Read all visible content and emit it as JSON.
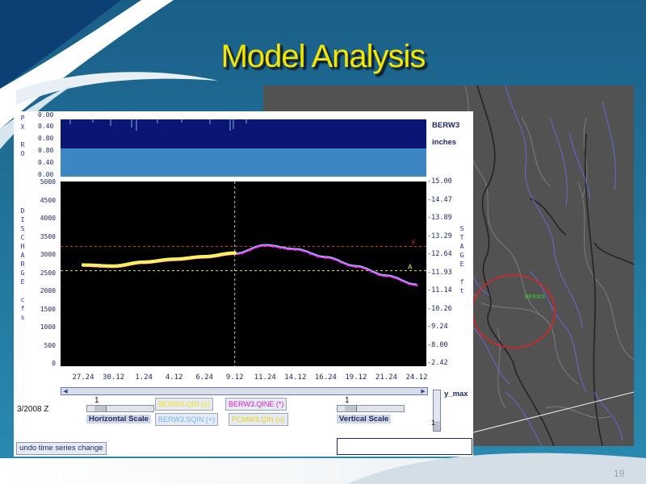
{
  "slide": {
    "title": "Model Analysis",
    "page_number": "19"
  },
  "top_strip": {
    "labels_left": [
      "P",
      "X",
      "",
      "R",
      "O"
    ],
    "ticks": [
      "0.00",
      "0.40",
      "0.80",
      "0.80",
      "0.40",
      "0.00"
    ],
    "station": "BERW3",
    "units": "inches"
  },
  "discharge_plot": {
    "left_axis_label": "DISCHARGE  cfs",
    "left_ticks": [
      "5000",
      "4500",
      "4000",
      "3500",
      "3000",
      "2500",
      "2000",
      "1500",
      "1000",
      "500",
      "0"
    ],
    "right_axis_label": "STAGE ft",
    "right_ticks": [
      "15.00",
      "14.47",
      "13.89",
      "13.29",
      "12.64",
      "11.93",
      "11.14",
      "10.26",
      "9.24",
      "8.00",
      "2.42"
    ],
    "x_ticks": [
      "27.24",
      "30.12",
      "1.24",
      "4.12",
      "6.24",
      "9.12",
      "11.24",
      "14.12",
      "16.24",
      "19.12",
      "21.24",
      "24.12"
    ],
    "flood_marker": "F",
    "action_marker": "A",
    "colors": {
      "background": "#000000",
      "observed": "#f5f25a",
      "simulated": "#ff33ff",
      "sqin": "#7fd8ff",
      "flood_line": "#d23a1a",
      "action_line": "#e8e84a",
      "cursor_line": "#c8c8c8"
    }
  },
  "chart_data": {
    "type": "line",
    "x": [
      "27.24",
      "30.12",
      "1.24",
      "4.12",
      "6.24",
      "9.12",
      "11.24",
      "14.12",
      "16.24",
      "19.12",
      "21.24",
      "24.12"
    ],
    "series": [
      {
        "name": "BERW3.QINE (*)",
        "values": [
          2750,
          2720,
          2830,
          2910,
          2980,
          3080,
          3320,
          3210,
          2990,
          2740,
          2480,
          2230
        ]
      },
      {
        "name": "BERW3.SQIN (+)",
        "values": [
          2770,
          2740,
          2850,
          2950,
          3010,
          3110,
          3350,
          3240,
          3020,
          2770,
          2510,
          2260
        ]
      }
    ],
    "ylim": [
      0,
      5000
    ],
    "flood_level": 3300,
    "action_level": 2630
  },
  "controls": {
    "date_text": "3/2008 Z",
    "horizontal_value": "1",
    "horizontal_label": "Horizontal Scale",
    "vertical_value": "1",
    "vertical_label": "Vertical Scale",
    "y_max_label": "y_max",
    "legend": [
      {
        "label": "BERW3.QIN (o)",
        "color": "#f5e21c"
      },
      {
        "label": "BERW3.QINE (*)",
        "color": "#d41cc4"
      },
      {
        "label": "BERW3.SQIN (+)",
        "color": "#6fb8e8"
      },
      {
        "label": "PCMW3.QIN (o)",
        "color": "#e8d21c"
      }
    ],
    "undo_label": "undo time series change"
  },
  "map": {
    "gage_label": "BERW3"
  }
}
